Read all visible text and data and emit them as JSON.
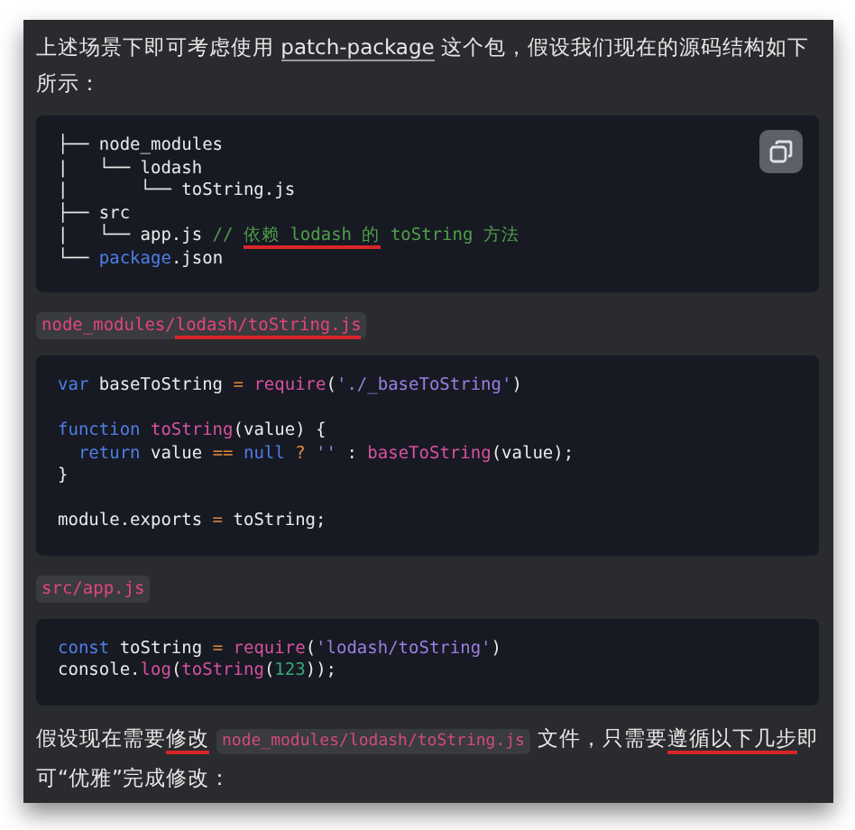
{
  "content": [
    {
      "kind": "paragraph",
      "segments": [
        {
          "kind": "text",
          "text": "上述场景下即可考虑使用 "
        },
        {
          "kind": "link",
          "text": "patch-package"
        },
        {
          "kind": "text",
          "text": " 这个包，假设我们现在的源码结构如下所示："
        }
      ]
    },
    {
      "kind": "code_block",
      "copy_button": true,
      "lines": [
        {
          "kind": "code",
          "tokens": [
            {
              "kind": "plain",
              "text": "├── node_modules"
            }
          ]
        },
        {
          "kind": "code",
          "tokens": [
            {
              "kind": "plain",
              "text": "|   └── lodash"
            }
          ]
        },
        {
          "kind": "code",
          "tokens": [
            {
              "kind": "plain",
              "text": "|       └── toString.js"
            }
          ]
        },
        {
          "kind": "code",
          "tokens": [
            {
              "kind": "plain",
              "text": "├── src"
            }
          ]
        },
        {
          "kind": "code",
          "tokens": [
            {
              "kind": "plain",
              "text": "|   └── app.js "
            },
            {
              "kind": "comment",
              "text": "// "
            },
            {
              "kind": "comment",
              "text": "依赖 lodash 的",
              "underlined": true
            },
            {
              "kind": "comment",
              "text": " toString 方法"
            }
          ]
        },
        {
          "kind": "code",
          "tokens": [
            {
              "kind": "plain",
              "text": "└── "
            },
            {
              "kind": "keyword",
              "text": "package"
            },
            {
              "kind": "plain",
              "text": ".json"
            }
          ]
        }
      ]
    },
    {
      "kind": "file_label",
      "segments": [
        {
          "text": "node_modules/"
        },
        {
          "text": "lodash/toString.js",
          "underlined": true
        }
      ]
    },
    {
      "kind": "code_block",
      "copy_button": false,
      "lines": [
        {
          "kind": "code",
          "tokens": [
            {
              "kind": "keyword",
              "text": "var"
            },
            {
              "kind": "plain",
              "text": " baseToString "
            },
            {
              "kind": "operator",
              "text": "="
            },
            {
              "kind": "function",
              "text": " require"
            },
            {
              "kind": "plain",
              "text": "("
            },
            {
              "kind": "string",
              "text": "'./_baseToString'"
            },
            {
              "kind": "plain",
              "text": ")"
            }
          ]
        },
        {
          "kind": "blank"
        },
        {
          "kind": "code",
          "tokens": [
            {
              "kind": "keyword",
              "text": "function"
            },
            {
              "kind": "function",
              "text": " toString"
            },
            {
              "kind": "plain",
              "text": "(value) {"
            }
          ]
        },
        {
          "kind": "code",
          "tokens": [
            {
              "kind": "keyword",
              "text": "  return"
            },
            {
              "kind": "plain",
              "text": " value "
            },
            {
              "kind": "operator",
              "text": "=="
            },
            {
              "kind": "keyword",
              "text": " null"
            },
            {
              "kind": "operator",
              "text": " ?"
            },
            {
              "kind": "string",
              "text": " ''"
            },
            {
              "kind": "plain",
              "text": " : "
            },
            {
              "kind": "function",
              "text": "baseToString"
            },
            {
              "kind": "plain",
              "text": "(value);"
            }
          ]
        },
        {
          "kind": "code",
          "tokens": [
            {
              "kind": "plain",
              "text": "}"
            }
          ]
        },
        {
          "kind": "blank"
        },
        {
          "kind": "code",
          "tokens": [
            {
              "kind": "plain",
              "text": "module.exports "
            },
            {
              "kind": "operator",
              "text": "="
            },
            {
              "kind": "plain",
              "text": " toString;"
            }
          ]
        }
      ]
    },
    {
      "kind": "file_label",
      "segments": [
        {
          "text": "src/app.js"
        }
      ]
    },
    {
      "kind": "code_block",
      "copy_button": false,
      "lines": [
        {
          "kind": "code",
          "tokens": [
            {
              "kind": "keyword",
              "text": "const"
            },
            {
              "kind": "plain",
              "text": " toString "
            },
            {
              "kind": "operator",
              "text": "="
            },
            {
              "kind": "function",
              "text": " require"
            },
            {
              "kind": "plain",
              "text": "("
            },
            {
              "kind": "string",
              "text": "'lodash/toString'"
            },
            {
              "kind": "plain",
              "text": ")"
            }
          ]
        },
        {
          "kind": "code",
          "tokens": [
            {
              "kind": "plain",
              "text": "console."
            },
            {
              "kind": "function",
              "text": "log"
            },
            {
              "kind": "plain",
              "text": "("
            },
            {
              "kind": "function",
              "text": "toString"
            },
            {
              "kind": "plain",
              "text": "("
            },
            {
              "kind": "number",
              "text": "123"
            },
            {
              "kind": "plain",
              "text": "));"
            }
          ]
        }
      ]
    },
    {
      "kind": "paragraph",
      "segments": [
        {
          "kind": "text",
          "text": "假设现在需要"
        },
        {
          "kind": "text",
          "text": "修改",
          "underlined": true
        },
        {
          "kind": "code",
          "text": "node_modules/lodash/toString.js"
        },
        {
          "kind": "text",
          "text": "文件，只需要"
        },
        {
          "kind": "text",
          "text": "遵循以下几步",
          "underlined": true
        },
        {
          "kind": "text",
          "text": "即可“优雅”完成修改："
        }
      ]
    }
  ]
}
